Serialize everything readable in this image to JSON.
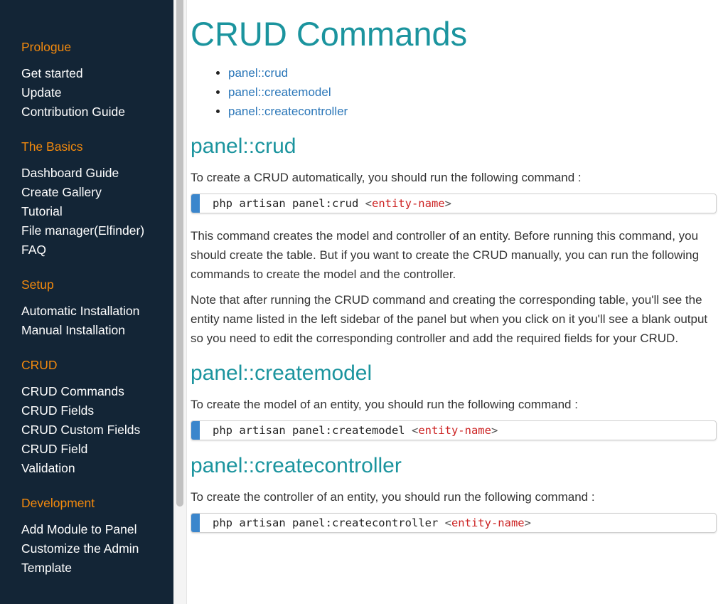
{
  "sidebar": {
    "sections": [
      {
        "heading": "Prologue",
        "items": [
          "Get started",
          "Update",
          "Contribution Guide"
        ]
      },
      {
        "heading": "The Basics",
        "items": [
          "Dashboard Guide",
          "Create Gallery",
          "Tutorial",
          "File manager(Elfinder)",
          "FAQ"
        ]
      },
      {
        "heading": "Setup",
        "items": [
          "Automatic Installation",
          "Manual Installation"
        ]
      },
      {
        "heading": "CRUD",
        "items": [
          "CRUD Commands",
          "CRUD Fields",
          "CRUD Custom Fields",
          "CRUD Field",
          "Validation"
        ]
      },
      {
        "heading": "Development",
        "items": [
          "Add Module to Panel",
          "Customize the Admin",
          "Template"
        ]
      }
    ]
  },
  "colors": {
    "sidebar_bg": "#132536",
    "section_heading": "#f2890d",
    "title": "#1b949e",
    "link": "#2a76b8",
    "code_accent": "#3b86cc",
    "code_arg": "#cc2222"
  },
  "main": {
    "title": "CRUD Commands",
    "toc": [
      "panel::crud",
      "panel::createmodel",
      "panel::createcontroller"
    ],
    "sections": [
      {
        "heading": "panel::crud",
        "intro": "To create a CRUD automatically, you should run the following command :",
        "code": {
          "command": "php artisan panel:crud ",
          "open": "<",
          "arg": "entity-name",
          "close": ">"
        },
        "paragraphs": [
          "This command creates the model and controller of an entity. Before running this command, you should create the table. But if you want to create the CRUD manually, you can run the following commands to create the model and the controller.",
          "Note that after running the CRUD command and creating the corresponding table, you'll see the entity name listed in the left sidebar of the panel but when you click on it you'll see a blank output so you need to edit the corresponding controller and add the required fields for your CRUD."
        ]
      },
      {
        "heading": "panel::createmodel",
        "intro": "To create the model of an entity, you should run the following command :",
        "code": {
          "command": "php artisan panel:createmodel ",
          "open": "<",
          "arg": "entity-name",
          "close": ">"
        }
      },
      {
        "heading": "panel::createcontroller",
        "intro": "To create the controller of an entity, you should run the following command :",
        "code": {
          "command": "php artisan panel:createcontroller ",
          "open": "<",
          "arg": "entity-name",
          "close": ">"
        }
      }
    ]
  }
}
